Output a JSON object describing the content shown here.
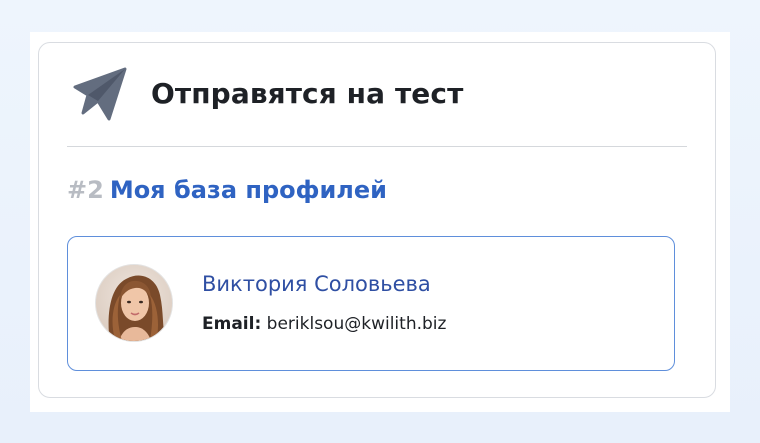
{
  "header": {
    "title": "Отправятся на тест",
    "icon": "send-icon"
  },
  "base": {
    "number": "#2",
    "name": "Моя база профилей"
  },
  "profile": {
    "name": "Виктория Соловьева",
    "email_label": "Email:",
    "email": "beriklsou@kwilith.biz",
    "avatar": "avatar-photo"
  },
  "colors": {
    "accent": "#2f63c2",
    "profile_border": "#5f8fdb",
    "icon": "#636d7f"
  }
}
